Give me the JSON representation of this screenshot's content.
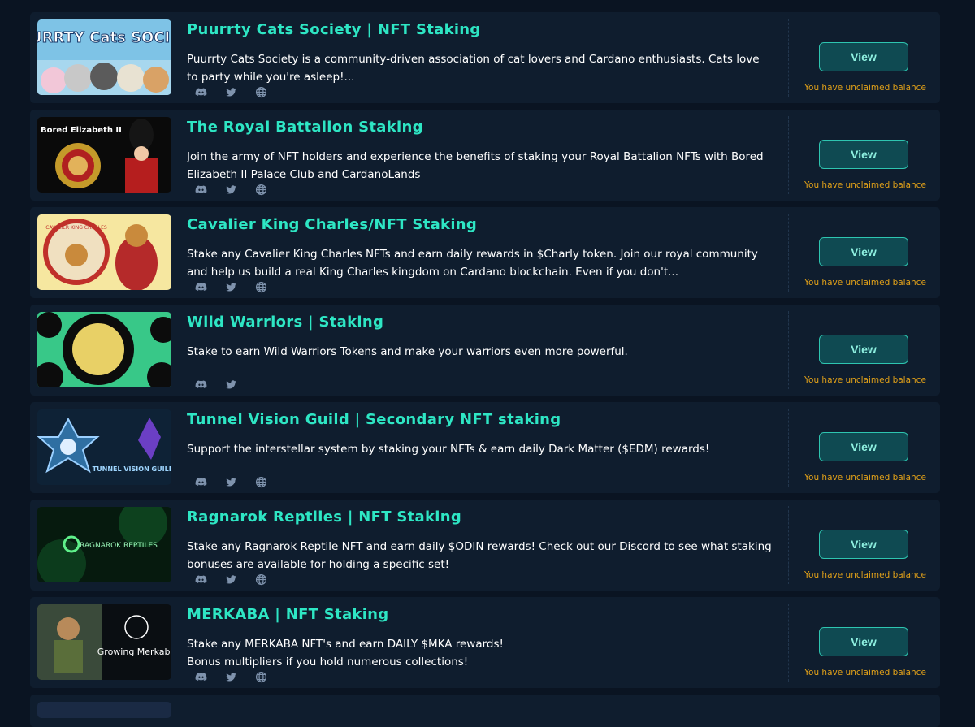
{
  "colors": {
    "background": "#0a1422",
    "card": "#0f1d2e",
    "title": "#2ee6c4",
    "button_bg": "#0f4a52",
    "button_border": "#2ec5b0",
    "notice": "#e0a019"
  },
  "projects": [
    {
      "title": "Puurrty Cats Society | NFT Staking",
      "description": "Puurrty Cats Society is a community-driven association of cat lovers and Cardano enthusiasts. Cats love to party while you're asleep!...",
      "image_text": "PUURRTY Cats SOCIETY",
      "socials": [
        "discord-icon",
        "twitter-icon",
        "globe-icon"
      ],
      "button_label": "View",
      "notice": "You have unclaimed balance"
    },
    {
      "title": "The Royal Battalion Staking",
      "description": "Join the army of NFT holders and experience the benefits of staking your Royal Battalion NFTs with Bored Elizabeth II Palace Club and CardanoLands",
      "image_text": "Bored Elizabeth II",
      "socials": [
        "discord-icon",
        "twitter-icon",
        "globe-icon"
      ],
      "button_label": "View",
      "notice": "You have unclaimed balance"
    },
    {
      "title": "Cavalier King Charles/NFT Staking",
      "description": "Stake any Cavalier King Charles NFTs and earn daily rewards in $Charly token. Join our royal community and help us build a real King Charles kingdom on Cardano blockchain. Even if you don't...",
      "image_text": "CAVALIER KING CHARLES",
      "socials": [
        "discord-icon",
        "twitter-icon",
        "globe-icon"
      ],
      "button_label": "View",
      "notice": "You have unclaimed balance"
    },
    {
      "title": "Wild Warriors | Staking",
      "description": "Stake to earn Wild Warriors Tokens and make your warriors even more powerful.",
      "image_text": "",
      "socials": [
        "discord-icon",
        "twitter-icon"
      ],
      "button_label": "View",
      "notice": "You have unclaimed balance"
    },
    {
      "title": "Tunnel Vision Guild | Secondary NFT staking",
      "description": "Support the interstellar system by staking your NFTs & earn daily Dark Matter ($EDM) rewards!",
      "image_text": "TUNNEL VISION GUILD",
      "socials": [
        "discord-icon",
        "twitter-icon",
        "globe-icon"
      ],
      "button_label": "View",
      "notice": "You have unclaimed balance"
    },
    {
      "title": "Ragnarok Reptiles | NFT Staking",
      "description": "Stake any Ragnarok Reptile NFT and earn daily $ODIN rewards! Check out our Discord to see what staking bonuses are available for holding a specific set!",
      "image_text": "RAGNAROK REPTILES",
      "socials": [
        "discord-icon",
        "twitter-icon",
        "globe-icon"
      ],
      "button_label": "View",
      "notice": "You have unclaimed balance"
    },
    {
      "title": "MERKABA | NFT Staking",
      "description": "Stake any MERKABA NFT's and earn DAILY $MKA rewards!\nBonus multipliers if you hold numerous collections!",
      "image_text": "Growing Merkaba",
      "socials": [
        "discord-icon",
        "twitter-icon",
        "globe-icon"
      ],
      "button_label": "View",
      "notice": "You have unclaimed balance"
    }
  ]
}
